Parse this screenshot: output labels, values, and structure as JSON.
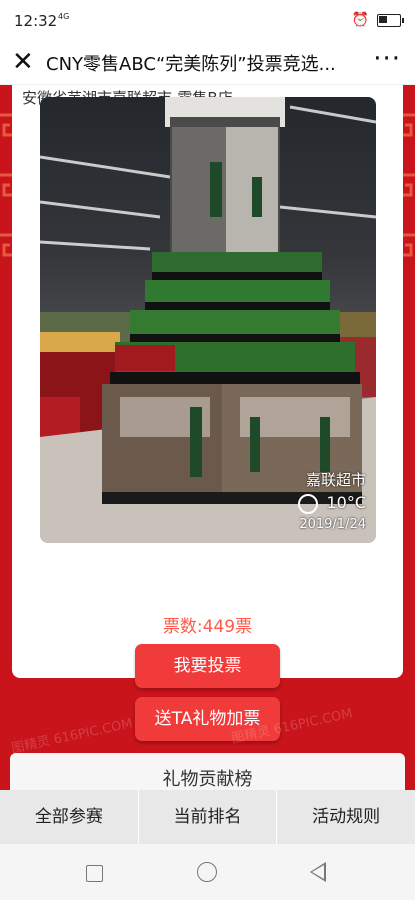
{
  "status_bar": {
    "time": "12:32",
    "network": "4G"
  },
  "header": {
    "title": "CNY零售ABC“完美陈列”投票竞选..."
  },
  "entry": {
    "location": "安徽省芜湖市嘉联超市-零售B店",
    "photo_watermark": {
      "store": "嘉联超市",
      "temperature": "10°C",
      "date": "2019/1/24"
    },
    "vote_count": "票数:449票"
  },
  "actions": {
    "vote_label": "我要投票",
    "gift_label": "送TA礼物加票"
  },
  "ranking": {
    "title": "礼物贡献榜"
  },
  "site_watermark": "图精灵 616PIC.COM",
  "bottom_nav": [
    {
      "label": "全部参赛"
    },
    {
      "label": "当前排名"
    },
    {
      "label": "活动规则"
    }
  ],
  "colors": {
    "background_red": "#c8141a",
    "button_red": "#f13a3a",
    "vote_text": "#ff5a4a"
  }
}
